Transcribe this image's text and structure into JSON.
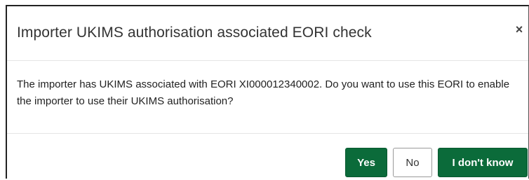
{
  "dialog": {
    "title": "Importer UKIMS authorisation associated EORI check",
    "close_label": "×",
    "message": "The importer has UKIMS associated with EORI XI000012340002. Do you want to use this EORI to enable the importer to use their UKIMS authorisation?",
    "buttons": {
      "yes": "Yes",
      "no": "No",
      "dont_know": "I don't know"
    }
  },
  "colors": {
    "primary_button": "#0b6b3a",
    "secondary_button_border": "#9a9a9a"
  }
}
